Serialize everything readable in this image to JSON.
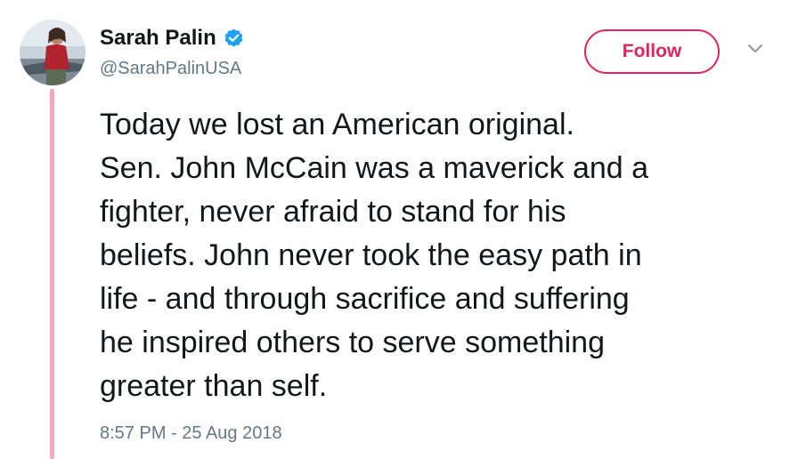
{
  "tweet": {
    "author": {
      "display_name": "Sarah Palin",
      "handle": "@SarahPalinUSA",
      "verified": true
    },
    "follow_label": "Follow",
    "text_lines": [
      "Today we lost an American original.",
      "Sen. John McCain was a maverick and a",
      "fighter, never afraid to stand for his",
      "beliefs. John never took the easy path in",
      "life - and through sacrifice and suffering",
      "he inspired others to serve something",
      "greater than self."
    ],
    "timestamp": "8:57 PM - 25 Aug 2018"
  },
  "icons": {
    "verified": "verified-badge-icon",
    "menu": "chevron-down-icon"
  },
  "colors": {
    "accent": "#e0245e",
    "thread_line": "#f3a8c0",
    "verified_blue": "#1da1f2",
    "secondary_text": "#657786",
    "primary_text": "#14171a"
  }
}
